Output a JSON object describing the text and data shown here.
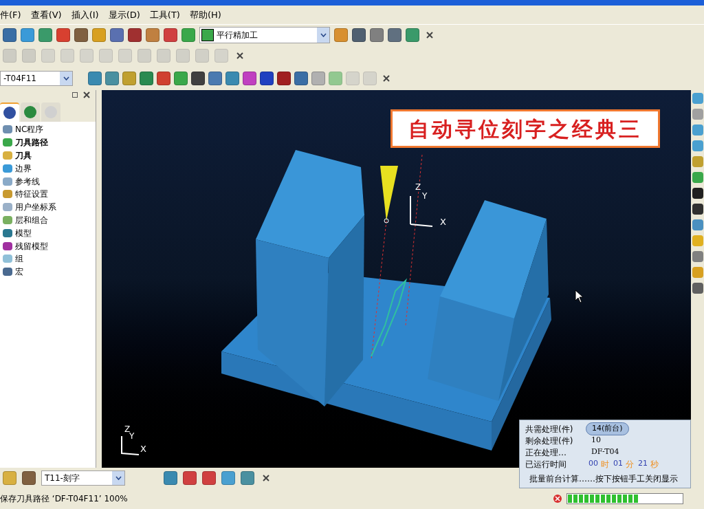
{
  "menu": [
    "件(F)",
    "查看(V)",
    "插入(I)",
    "显示(D)",
    "工具(T)",
    "帮助(H)"
  ],
  "toolbar_1": {
    "strategy": "平行精加工"
  },
  "toolbar_3": {
    "toolpath": "-T04F11"
  },
  "explorer": {
    "tabs": [
      {
        "selected": true
      },
      {
        "selected": false
      },
      {
        "selected": false
      }
    ],
    "items": [
      {
        "label": "NC程序",
        "bold": false,
        "color": "#6f8fb0"
      },
      {
        "label": "刀具路径",
        "bold": true,
        "color": "#3aa84a"
      },
      {
        "label": "刀具",
        "bold": true,
        "color": "#d8b040"
      },
      {
        "label": "边界",
        "bold": false,
        "color": "#3a9ad8"
      },
      {
        "label": "参考线",
        "bold": false,
        "color": "#8aaac8"
      },
      {
        "label": "特征设置",
        "bold": false,
        "color": "#c89a30"
      },
      {
        "label": "用户坐标系",
        "bold": false,
        "color": "#9ab0c8"
      },
      {
        "label": "层和组合",
        "bold": false,
        "color": "#7ab060"
      },
      {
        "label": "模型",
        "bold": false,
        "color": "#2a7890"
      },
      {
        "label": "残留模型",
        "bold": false,
        "color": "#a030a0"
      },
      {
        "label": "组",
        "bold": false,
        "color": "#90c0d8"
      },
      {
        "label": "宏",
        "bold": false,
        "color": "#4a6a90"
      }
    ]
  },
  "viewport": {
    "banner": "自动寻位刻字之经典三",
    "tool_axes": [
      "Z",
      "Y",
      "X"
    ],
    "view_axes": [
      "Z",
      "Y",
      "X"
    ]
  },
  "batch_dialog": {
    "rows": [
      {
        "label": "共需处理(件)",
        "value": "14(前台)",
        "kind": "pill"
      },
      {
        "label": "剩余处理(件)",
        "value": "10",
        "kind": "text"
      },
      {
        "label": "正在处理…",
        "value": "DF-T04",
        "kind": "text"
      }
    ],
    "time_label": "已运行时间",
    "time": [
      {
        "value": "00",
        "unit": "时"
      },
      {
        "value": "01",
        "unit": "分"
      },
      {
        "value": "21",
        "unit": "秒"
      }
    ],
    "note": "批量前台计算……按下按钮手工关闭显示"
  },
  "bottom_toolbar": {
    "tool": "T11-刻字"
  },
  "status_bar": {
    "message": "保存刀具路径 ‘DF-T04F11’ 100%",
    "progress": {
      "level": 0.62
    }
  }
}
